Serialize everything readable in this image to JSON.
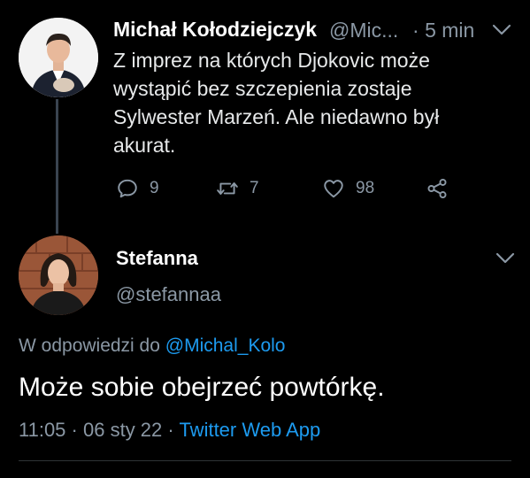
{
  "tweet1": {
    "author_name": "Michał Kołodziejczyk",
    "author_handle": "@Mic...",
    "separator": "·",
    "time": "5 min",
    "text": "Z imprez na których Djokovic może wystąpić bez szczepienia zostaje Sylwester Marzeń. Ale niedawno był akurat.",
    "actions": {
      "reply_icon": "reply-icon",
      "reply_count": "9",
      "retweet_icon": "retweet-icon",
      "retweet_count": "7",
      "like_icon": "heart-icon",
      "like_count": "98",
      "share_icon": "share-icon"
    }
  },
  "tweet2": {
    "author_name": "Stefanna",
    "author_handle": "@stefannaa",
    "replying_prefix": "W odpowiedzi do",
    "replying_to": "@Michal_Kolo",
    "text": "Może sobie obejrzeć powtórkę.",
    "time": "11:05",
    "separator1": "·",
    "date": "06 sty 22",
    "separator2": "·",
    "app": "Twitter Web App"
  },
  "colors": {
    "background": "#000000",
    "text_primary": "#e7e9ea",
    "text_secondary": "#8b98a5",
    "accent": "#1d9bf0"
  }
}
